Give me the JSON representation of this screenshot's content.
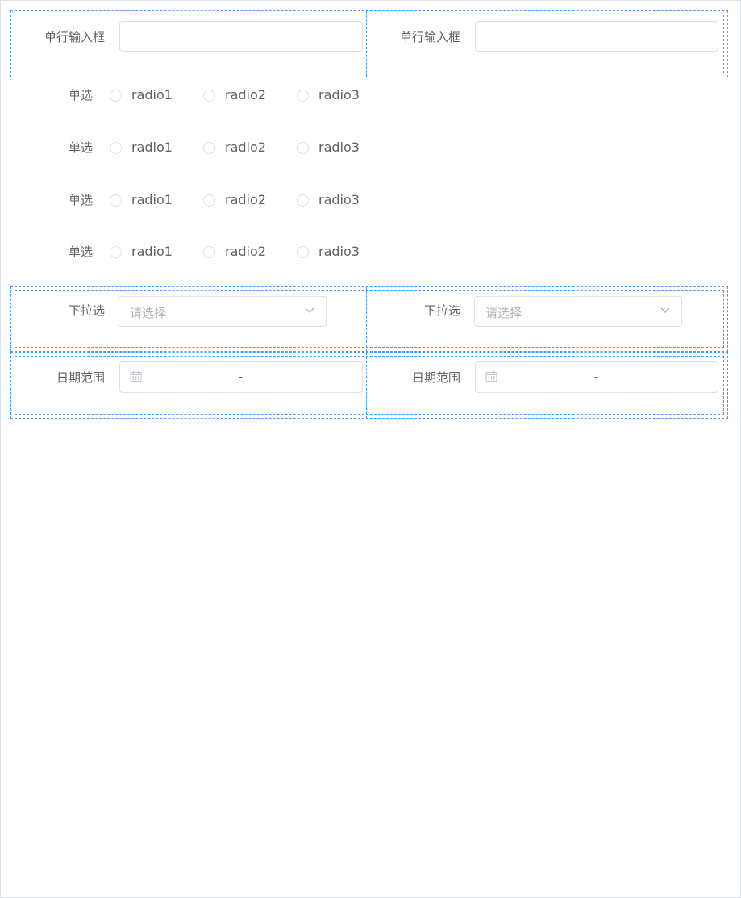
{
  "row1": {
    "left": {
      "label": "单行输入框",
      "value": ""
    },
    "right": {
      "label": "单行输入框",
      "value": ""
    }
  },
  "radios": [
    {
      "label": "单选",
      "options": [
        "radio1",
        "radio2",
        "radio3"
      ]
    },
    {
      "label": "单选",
      "options": [
        "radio1",
        "radio2",
        "radio3"
      ]
    },
    {
      "label": "单选",
      "options": [
        "radio1",
        "radio2",
        "radio3"
      ]
    },
    {
      "label": "单选",
      "options": [
        "radio1",
        "radio2",
        "radio3"
      ]
    }
  ],
  "selects": {
    "left": {
      "label": "下拉选",
      "placeholder": "请选择"
    },
    "right": {
      "label": "下拉选",
      "placeholder": "请选择"
    }
  },
  "dates": {
    "left": {
      "label": "日期范围",
      "separator": "-"
    },
    "right": {
      "label": "日期范围",
      "separator": "-"
    }
  },
  "colors": {
    "accent": "#409eff",
    "border": "#dcdfe6",
    "text": "#606266",
    "placeholder": "#b0b3ba"
  },
  "icons": {
    "select_arrow": "chevron-down-icon",
    "date": "calendar-icon"
  }
}
